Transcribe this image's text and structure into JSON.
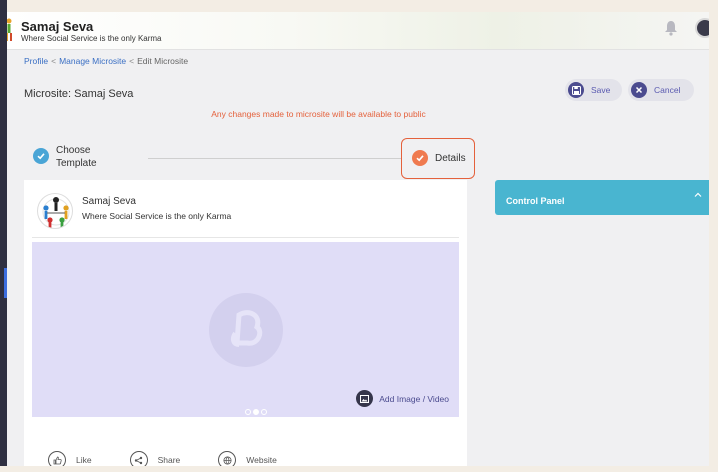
{
  "header": {
    "brand_title": "Samaj Seva",
    "brand_subtitle": "Where Social Service is the only Karma"
  },
  "breadcrumb": {
    "items": [
      "Profile",
      "Manage Microsite",
      "Edit Microsite"
    ],
    "separator": "<"
  },
  "page": {
    "title": "Microsite: Samaj Seva",
    "notice": "Any changes made to microsite will be available to public"
  },
  "toolbar": {
    "save_label": "Save",
    "cancel_label": "Cancel"
  },
  "stepper": {
    "step1_label": "Choose Template",
    "step2_label": "Details"
  },
  "card": {
    "name": "Samaj Seva",
    "tagline": "Where Social Service is the only Karma",
    "add_media_label": "Add Image / Video",
    "actions": {
      "like": "Like",
      "share": "Share",
      "website": "Website"
    }
  },
  "control_panel": {
    "label": "Control Panel"
  },
  "colors": {
    "accent": "#4b4b8f",
    "notice": "#e4613c",
    "step_done": "#4aa5d6",
    "step_active": "#ef7a4f",
    "control_panel": "#49b5d0",
    "media_bg": "#e0ddf7"
  },
  "icons": {
    "save": "save-icon",
    "cancel": "close-icon",
    "bell": "bell-icon",
    "add_media": "image-icon",
    "like": "thumbs-up-icon",
    "share": "share-icon",
    "website": "globe-icon",
    "chevron": "chevron-up-icon"
  }
}
